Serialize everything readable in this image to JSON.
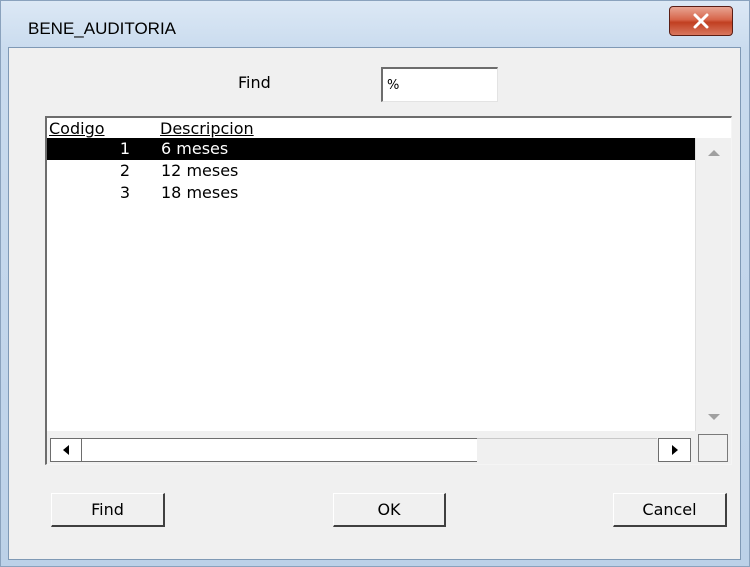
{
  "window": {
    "title": "BENE_AUDITORIA",
    "close_icon": "close-icon",
    "colors": {
      "frame": "#c9dbee",
      "close": "#c94a2c",
      "selection": "#000000"
    }
  },
  "search": {
    "label": "Find",
    "value": "%"
  },
  "list": {
    "columns": [
      "Codigo",
      "Descripcion"
    ],
    "rows": [
      {
        "codigo": "1",
        "descripcion": "6 meses"
      },
      {
        "codigo": "2",
        "descripcion": "12 meses"
      },
      {
        "codigo": "3",
        "descripcion": "18 meses"
      }
    ],
    "selected_row": 0
  },
  "buttons": {
    "find": "Find",
    "ok": "OK",
    "cancel": "Cancel"
  }
}
